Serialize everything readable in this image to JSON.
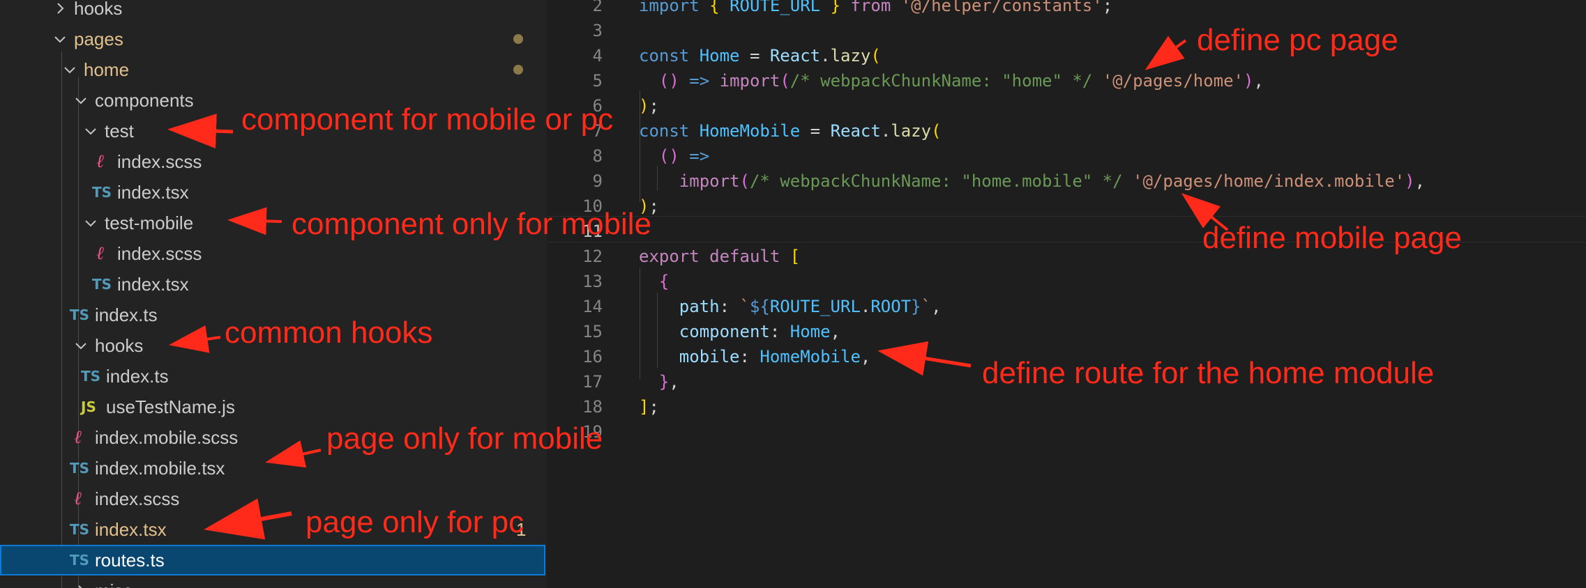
{
  "explorer": {
    "rows": [
      {
        "label": "hooks",
        "icon": "chevron-right-icon"
      },
      {
        "label": "pages",
        "icon": "chevron-down-icon",
        "modified": true
      },
      {
        "label": "home",
        "icon": "chevron-down-icon",
        "modified": true
      },
      {
        "label": "components",
        "icon": "chevron-down-icon"
      },
      {
        "label": "test",
        "icon": "chevron-down-icon"
      },
      {
        "label": "index.scss",
        "icon": "sass-file-icon"
      },
      {
        "label": "index.tsx",
        "icon": "typescript-file-icon",
        "badge": "TS"
      },
      {
        "label": "test-mobile",
        "icon": "chevron-down-icon"
      },
      {
        "label": "index.scss",
        "icon": "sass-file-icon"
      },
      {
        "label": "index.tsx",
        "icon": "typescript-file-icon",
        "badge": "TS"
      },
      {
        "label": "index.ts",
        "icon": "typescript-file-icon",
        "badge": "TS"
      },
      {
        "label": "hooks",
        "icon": "chevron-down-icon"
      },
      {
        "label": "index.ts",
        "icon": "typescript-file-icon",
        "badge": "TS"
      },
      {
        "label": "useTestName.js",
        "icon": "javascript-file-icon",
        "badge": "JS"
      },
      {
        "label": "index.mobile.scss",
        "icon": "sass-file-icon"
      },
      {
        "label": "index.mobile.tsx",
        "icon": "typescript-file-icon",
        "badge": "TS"
      },
      {
        "label": "index.scss",
        "icon": "sass-file-icon"
      },
      {
        "label": "index.tsx",
        "icon": "typescript-file-icon",
        "badge": "TS",
        "modified_label": true,
        "status": "1"
      },
      {
        "label": "routes.ts",
        "icon": "typescript-file-icon",
        "badge": "TS",
        "selected": true
      },
      {
        "label": "misc",
        "icon": "chevron-right-icon"
      }
    ],
    "colors": {
      "selected_bg": "#094771",
      "selected_border": "#0e7ad4",
      "modified": "#e2c08d"
    }
  },
  "editor": {
    "line_numbers": [
      "2",
      "3",
      "4",
      "5",
      "6",
      "7",
      "8",
      "9",
      "10",
      "11",
      "12",
      "13",
      "14",
      "15",
      "16",
      "17",
      "18",
      "19"
    ],
    "active_line": "11"
  },
  "annotations": {
    "define_pc_page": "define pc page",
    "define_mobile_page": "define mobile page",
    "define_route": "define route for the home module",
    "component_mobile_or_pc": "component for mobile or pc",
    "component_only_mobile": "component only for mobile",
    "common_hooks": "common hooks",
    "page_only_mobile": "page only for mobile",
    "page_only_pc": "page only for pc",
    "color": "#ff2a1a"
  }
}
